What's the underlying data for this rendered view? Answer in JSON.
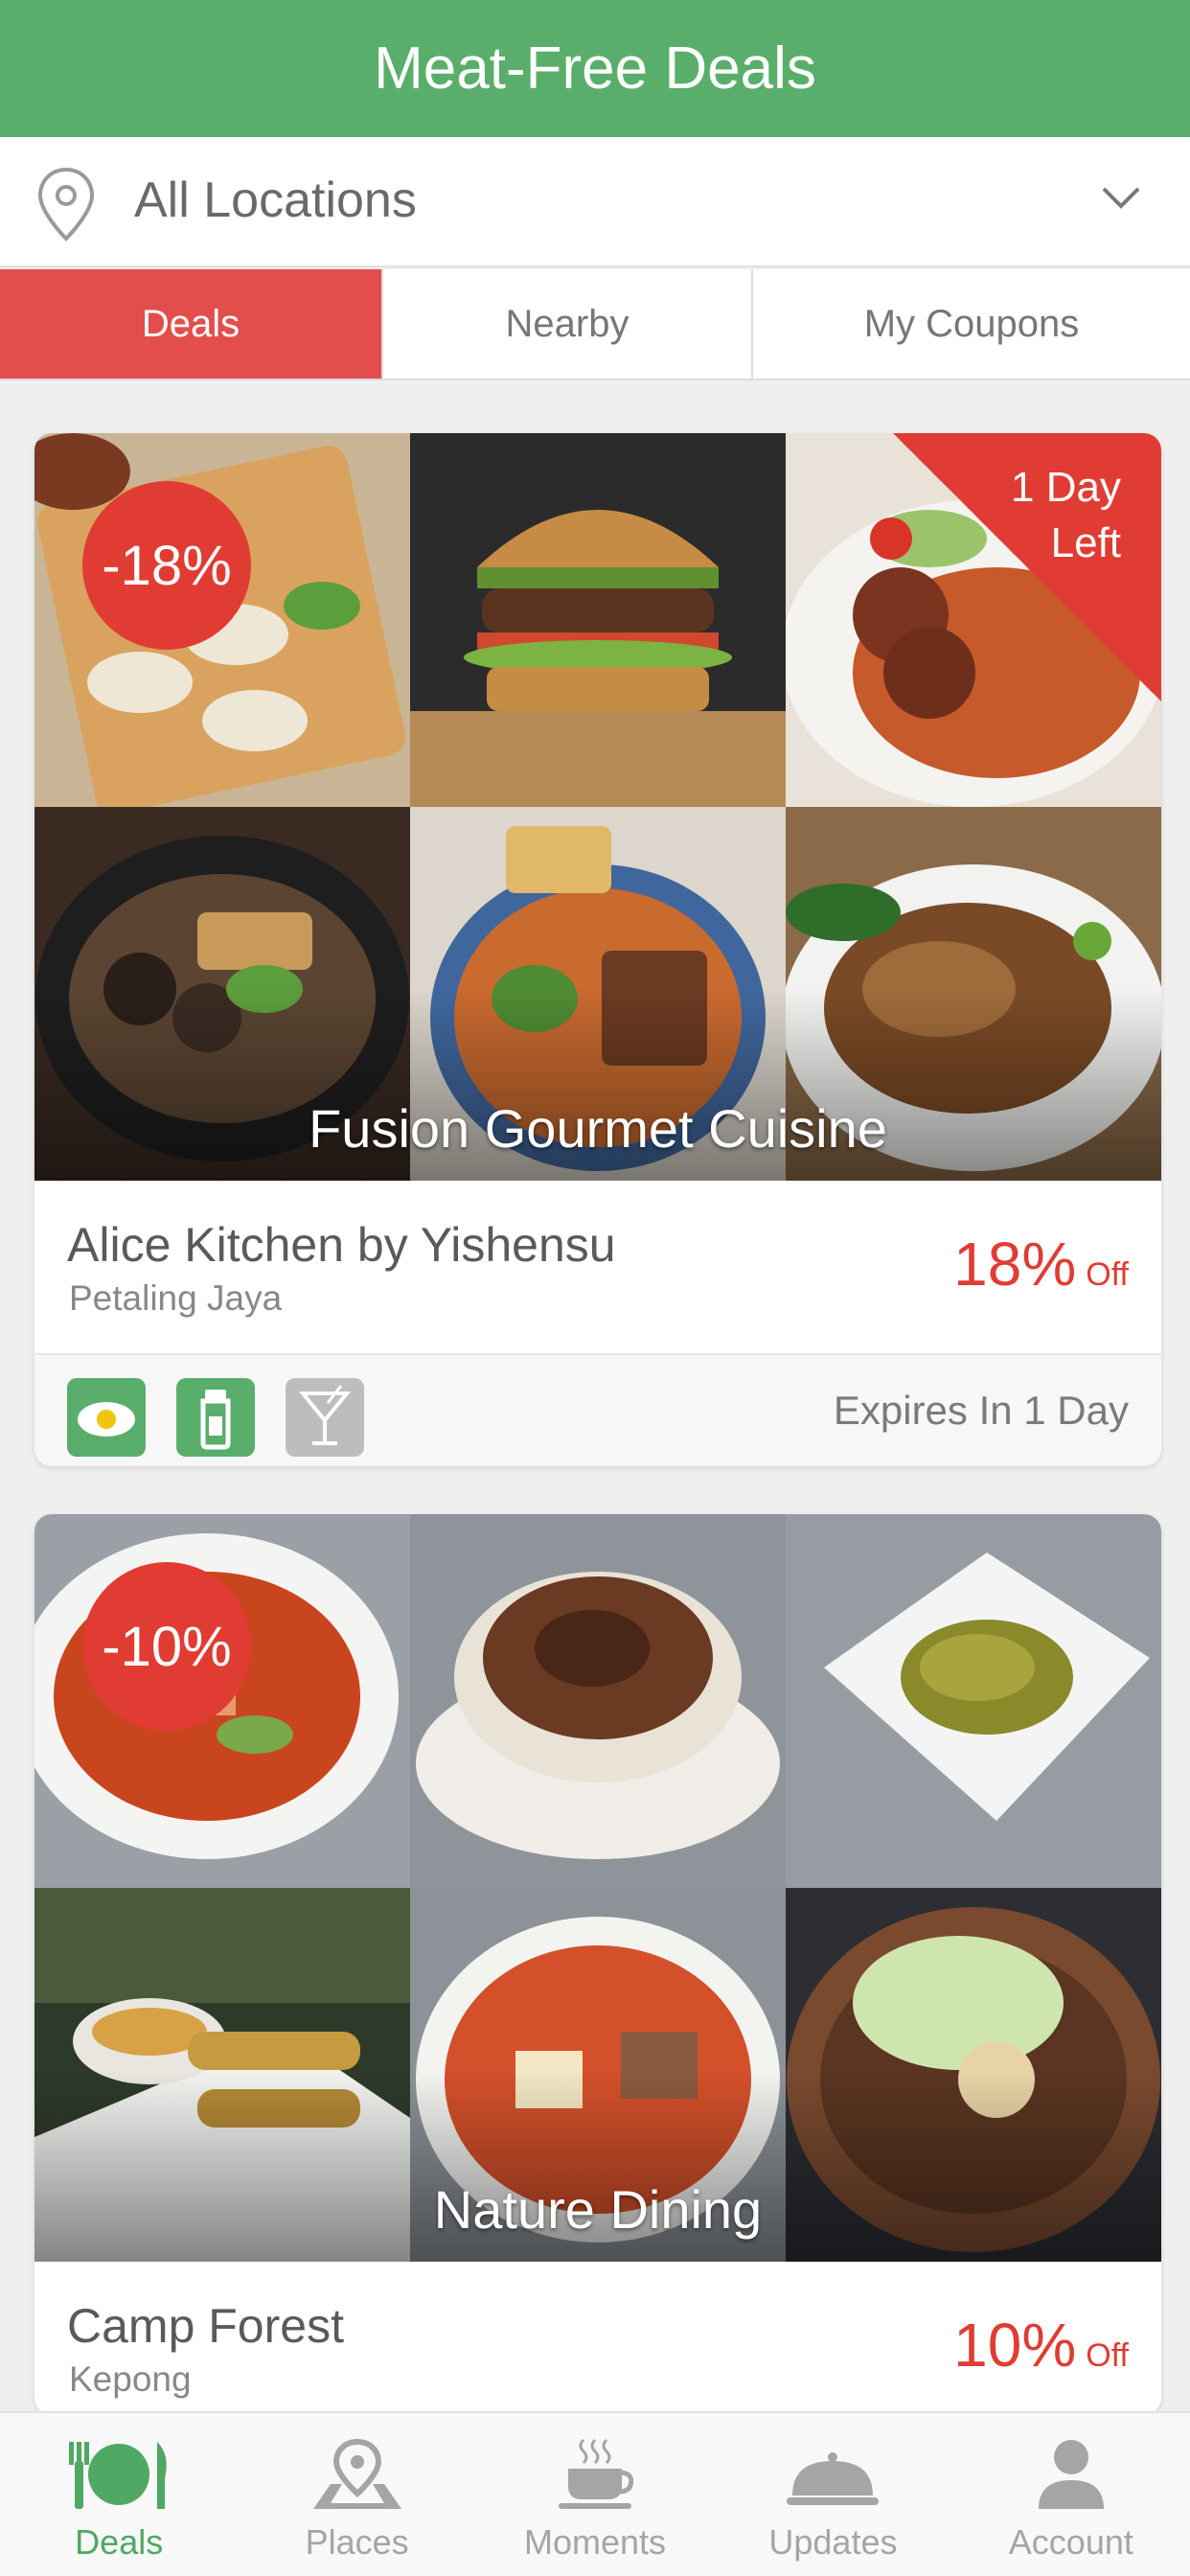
{
  "header": {
    "title": "Meat-Free Deals"
  },
  "location": {
    "label": "All Locations"
  },
  "tabs": [
    {
      "label": "Deals",
      "active": true
    },
    {
      "label": "Nearby",
      "active": false
    },
    {
      "label": "My Coupons",
      "active": false
    }
  ],
  "deals": [
    {
      "discount_badge": "-18%",
      "corner_ribbon": "1 Day Left",
      "cuisine": "Fusion Gourmet Cuisine",
      "restaurant": "Alice Kitchen by Yishensu",
      "area": "Petaling Jaya",
      "discount_value": "18%",
      "discount_suffix": "Off",
      "expires": "Expires In 1 Day",
      "diet_icons": [
        "egg-icon",
        "milk-bottle-icon",
        "cocktail-icon"
      ]
    },
    {
      "discount_badge": "-10%",
      "cuisine": "Nature Dining",
      "restaurant": "Camp Forest",
      "area": "Kepong",
      "discount_value": "10%",
      "discount_suffix": "Off"
    }
  ],
  "bottom_nav": [
    {
      "label": "Deals",
      "icon": "plate-cutlery-icon",
      "active": true
    },
    {
      "label": "Places",
      "icon": "map-pin-icon",
      "active": false
    },
    {
      "label": "Moments",
      "icon": "coffee-cup-icon",
      "active": false
    },
    {
      "label": "Updates",
      "icon": "cloche-icon",
      "active": false
    },
    {
      "label": "Account",
      "icon": "person-icon",
      "active": false
    }
  ],
  "colors": {
    "header_green": "#5aae6b",
    "accent_red": "#e03c33",
    "active_tab_red": "#e24e4b",
    "nav_active_green": "#4fa863"
  }
}
